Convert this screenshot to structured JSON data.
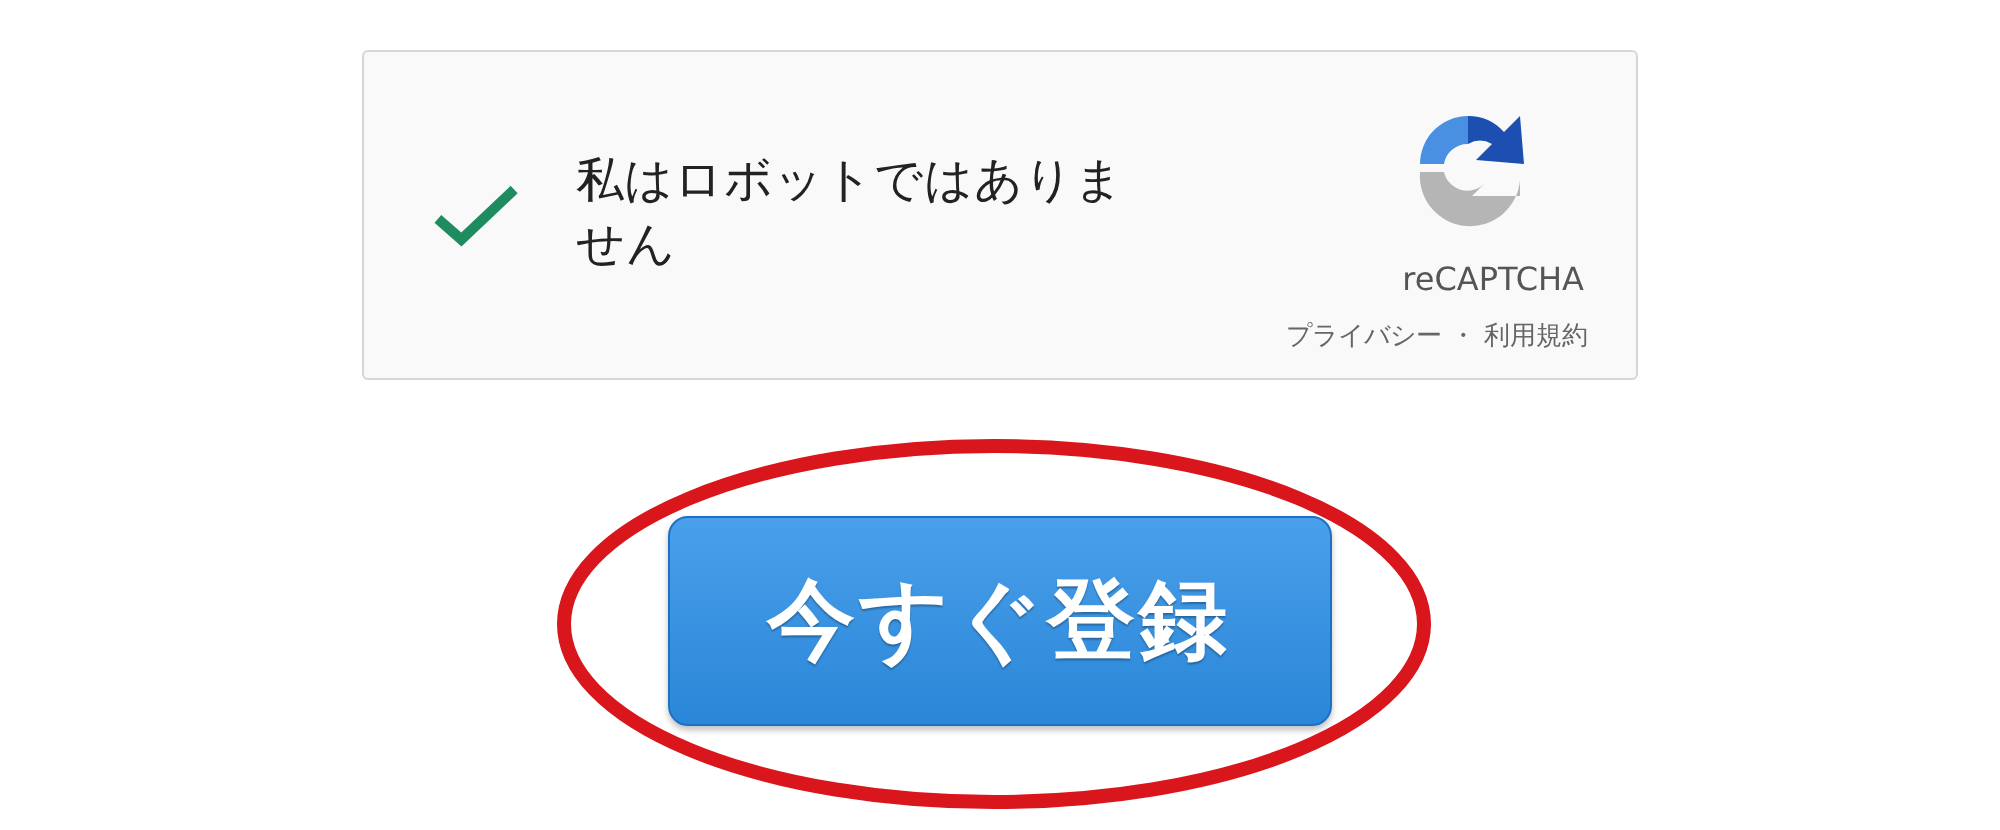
{
  "recaptcha": {
    "checked": true,
    "label": "私はロボットではありません",
    "brand": "reCAPTCHA",
    "links": [
      {
        "label": "プライバシー"
      },
      {
        "label": "利用規約"
      }
    ],
    "separator": "・"
  },
  "submit_button": {
    "label": "今すぐ登録",
    "highlighted": true
  }
}
